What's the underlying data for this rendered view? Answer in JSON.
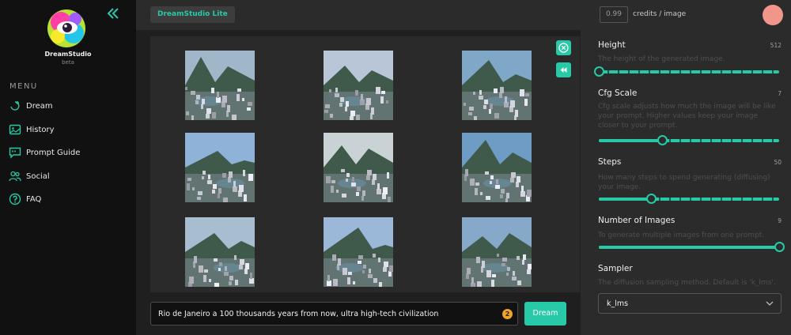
{
  "app": {
    "brand": "DreamStudio",
    "beta": "beta",
    "menu_label": "MENU",
    "studio_label": "DreamStudio Lite",
    "credits_value": "0.99",
    "credits_label": "credits / image"
  },
  "nav": [
    {
      "label": "Dream",
      "icon": "dream-icon"
    },
    {
      "label": "History",
      "icon": "history-icon"
    },
    {
      "label": "Prompt Guide",
      "icon": "prompt-guide-icon"
    },
    {
      "label": "Social",
      "icon": "social-icon"
    },
    {
      "label": "FAQ",
      "icon": "faq-icon"
    }
  ],
  "prompt": {
    "text": "Rio de Janeiro a 100 thousands years from now, ultra high-tech civilization",
    "count": "2",
    "dream_label": "Dream"
  },
  "settings": {
    "height": {
      "title": "Height",
      "value": "512",
      "desc": "The height of the generated image.",
      "level": 0.0
    },
    "cfg": {
      "title": "Cfg Scale",
      "value": "7",
      "desc": "Cfg scale adjusts how much the image will be like your prompt. Higher values keep your image closer to your prompt.",
      "level": 0.35
    },
    "steps": {
      "title": "Steps",
      "value": "50",
      "desc": "How many steps to spend generating (diffusing) your image.",
      "level": 0.29
    },
    "images": {
      "title": "Number of Images",
      "value": "9",
      "desc": "To generate multiple images from one prompt.",
      "level": 1.0
    },
    "sampler": {
      "title": "Sampler",
      "desc": "The diffusion sampling method. Default is 'k_lms'.",
      "value": "k_lms"
    }
  },
  "colors": {
    "accent": "#27c9a6",
    "avatar": "#f2968c",
    "badge": "#f0a326"
  }
}
